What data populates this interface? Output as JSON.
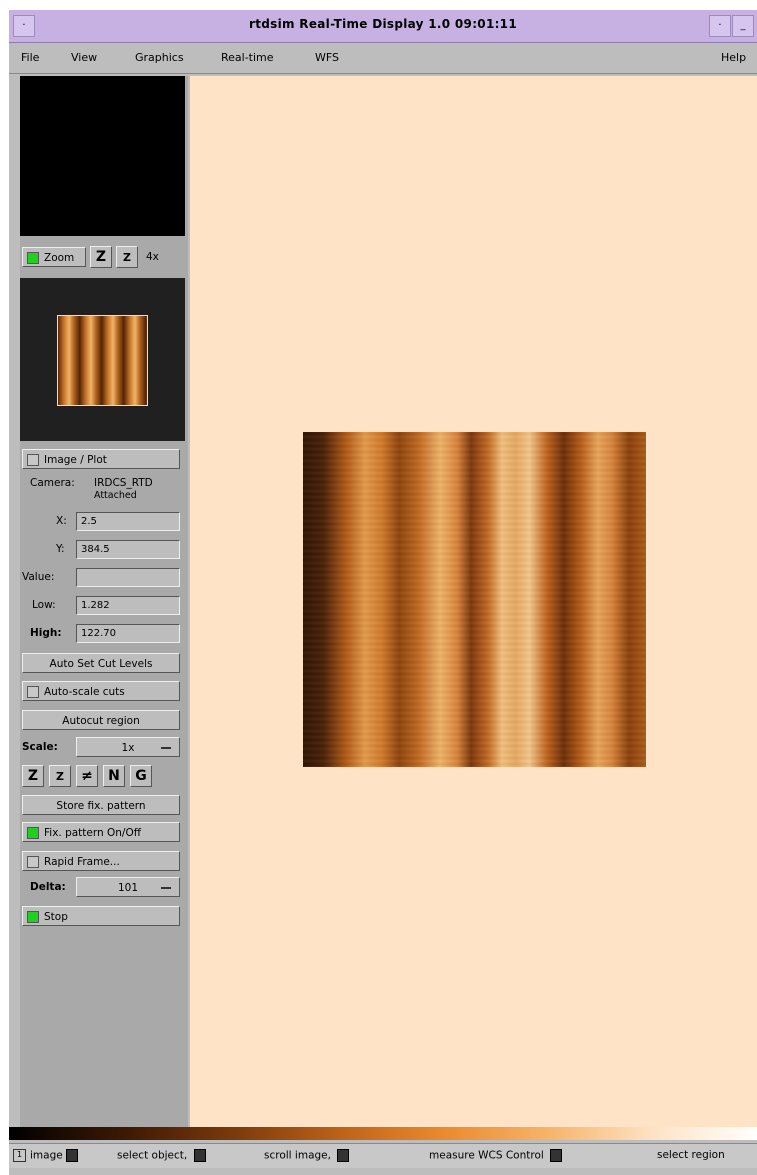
{
  "window": {
    "title": "rtdsim Real-Time Display 1.0 09:01:11"
  },
  "menu": {
    "file": "File",
    "view": "View",
    "graphics": "Graphics",
    "realtime": "Real-time",
    "wfs": "WFS",
    "help": "Help"
  },
  "zoom": {
    "label": "Zoom",
    "z_in": "Z",
    "z_out": "Z",
    "factor": "4x",
    "checked": true
  },
  "panel": {
    "image_plot": "Image / Plot",
    "camera_label": "Camera:",
    "camera_name": "IRDCS_RTD",
    "camera_status": "Attached",
    "x_label": "X:",
    "x_value": "2.5",
    "y_label": "Y:",
    "y_value": "384.5",
    "value_label": "Value:",
    "value_value": "",
    "low_label": "Low:",
    "low_value": "1.282",
    "high_label": "High:",
    "high_value": "122.70",
    "auto_set": "Auto Set Cut Levels",
    "autoscale": "Auto-scale cuts",
    "autocut_region": "Autocut region",
    "scale_label": "Scale:",
    "scale_value": "1x",
    "scale_icons": [
      "Z",
      "Z",
      "≠",
      "N",
      "G"
    ],
    "store_fixed": "Store fix. pattern",
    "fixed_onoff": "Fix. pattern On/Off",
    "rapid_frame": "Rapid Frame...",
    "delta_label": "Delta:",
    "delta_value": "101",
    "stop": "Stop",
    "fixed_checked": true,
    "stop_checked": true
  },
  "status": {
    "items": [
      "image",
      "select object, ",
      "scroll image, ",
      "measure WCS Control ",
      "select region"
    ]
  },
  "colors": {
    "title_bar": "#c7b1e3",
    "canvas": "#ffe3c6",
    "check_on": "#20d020"
  }
}
